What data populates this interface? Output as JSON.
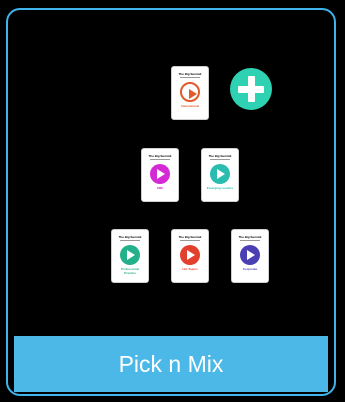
{
  "card": {
    "footer_label": "Pick n Mix",
    "colors": {
      "border": "#3fb3ea",
      "footer_bg": "#4bb8e8",
      "plus_bg": "#2fd1b3"
    }
  },
  "tablets": [
    {
      "brand": "The Big Summit",
      "caption": "International",
      "accent": "#e05a2a",
      "icon": "globe-icon"
    },
    {
      "brand": "The Big Summit",
      "caption": "SME",
      "accent": "#d42ad6",
      "icon": "store-icon"
    },
    {
      "brand": "The Big Summit",
      "caption": "Emerging Leaders",
      "accent": "#2bbcb0",
      "icon": "people-icon"
    },
    {
      "brand": "The Big Summit",
      "caption": "Professional Practice",
      "accent": "#23b08a",
      "icon": "document-icon"
    },
    {
      "brand": "The Big Summit",
      "caption": "Hot Topics",
      "accent": "#e2402d",
      "icon": "flame-icon"
    },
    {
      "brand": "The Big Summit",
      "caption": "Corporate",
      "accent": "#4a3fb3",
      "icon": "building-icon"
    }
  ],
  "plus_icon": "plus-icon"
}
